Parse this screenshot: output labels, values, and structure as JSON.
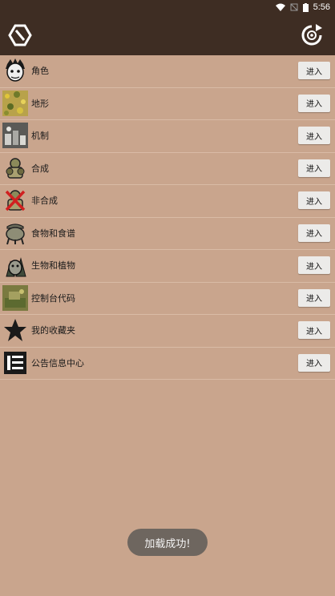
{
  "status": {
    "time": "5:56"
  },
  "menu": [
    {
      "label": "角色",
      "button": "进入",
      "icon": "character-icon"
    },
    {
      "label": "地形",
      "button": "进入",
      "icon": "terrain-icon"
    },
    {
      "label": "机制",
      "button": "进入",
      "icon": "mechanism-icon"
    },
    {
      "label": "合成",
      "button": "进入",
      "icon": "crafting-icon"
    },
    {
      "label": "非合成",
      "button": "进入",
      "icon": "non-crafting-icon"
    },
    {
      "label": "食物和食谱",
      "button": "进入",
      "icon": "crockpot-icon"
    },
    {
      "label": "生物和植物",
      "button": "进入",
      "icon": "creature-icon"
    },
    {
      "label": "控制台代码",
      "button": "进入",
      "icon": "console-icon"
    },
    {
      "label": "我的收藏夹",
      "button": "进入",
      "icon": "star-icon"
    },
    {
      "label": "公告信息中心",
      "button": "进入",
      "icon": "list-icon"
    }
  ],
  "toast": {
    "text": "加载成功!"
  }
}
